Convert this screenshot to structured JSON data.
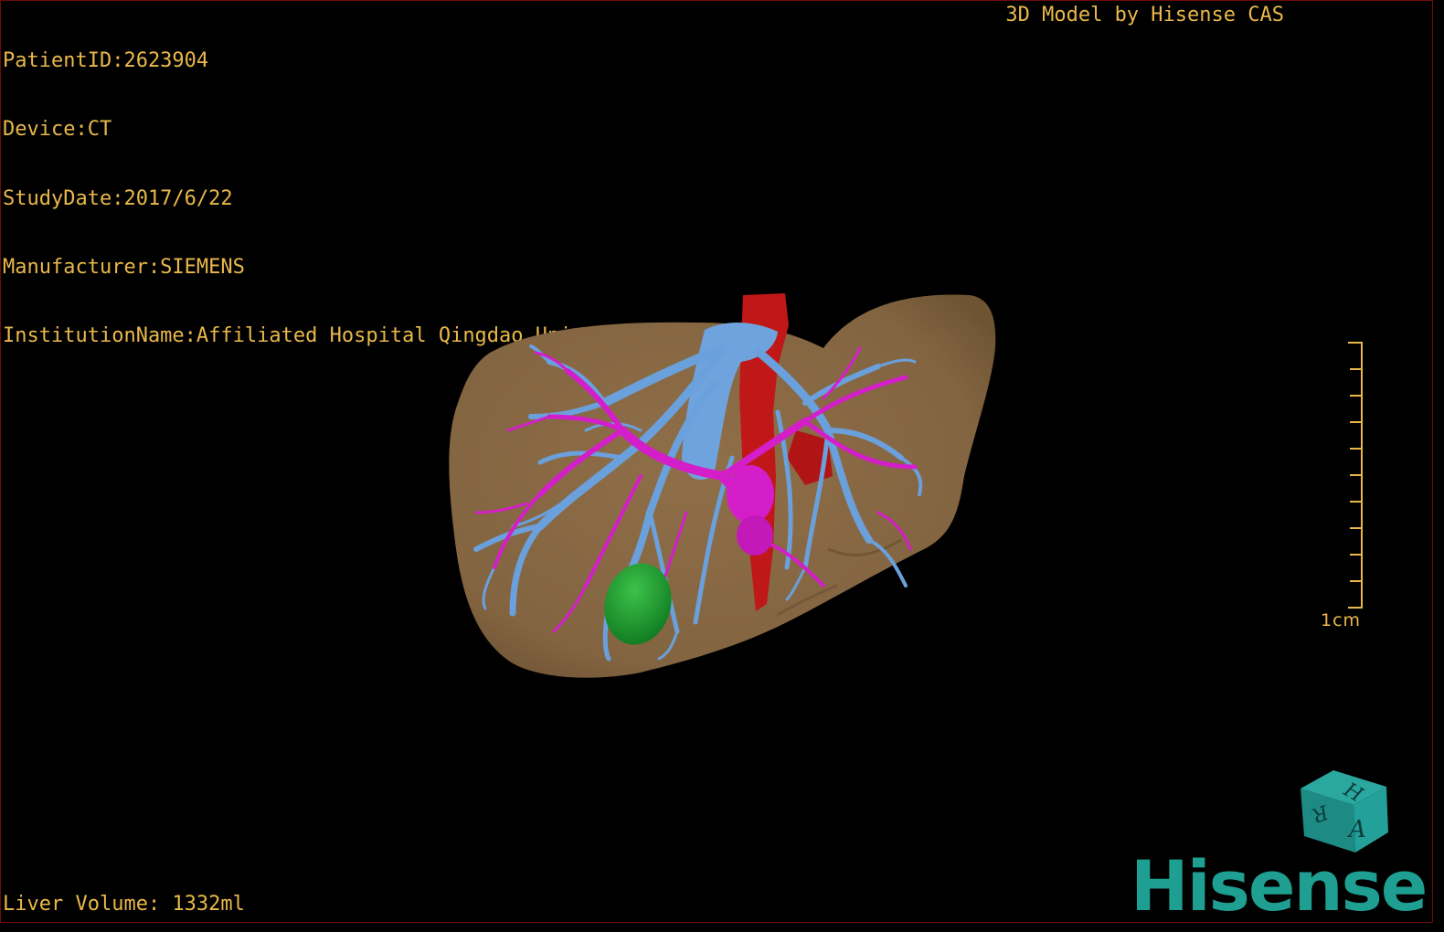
{
  "overlay": {
    "patient_id": "PatientID:2623904",
    "device": "Device:CT",
    "study_date": "StudyDate:2017/6/22",
    "manufacturer": "Manufacturer:SIEMENS",
    "institution": "InstitutionName:Affiliated Hospital Qingdao University-C",
    "credit": "3D Model by Hisense CAS",
    "liver_volume": "Liver Volume: 1332ml"
  },
  "scale_bar": {
    "label": "1cm"
  },
  "orientation_cube": {
    "faces": [
      "H",
      "R",
      "A"
    ]
  },
  "logo": {
    "text": "Hisense"
  },
  "colors": {
    "text": "#e9b84a",
    "liver": "#8b6b45",
    "portal_vein": "#6aa0dc",
    "hepatic_artery": "#d21ec8",
    "ivc": "#c01818",
    "lesion": "#1f9a2e",
    "brand": "#1f9e92"
  },
  "icons": [
    "orientation-cube-icon",
    "hisense-logo"
  ]
}
